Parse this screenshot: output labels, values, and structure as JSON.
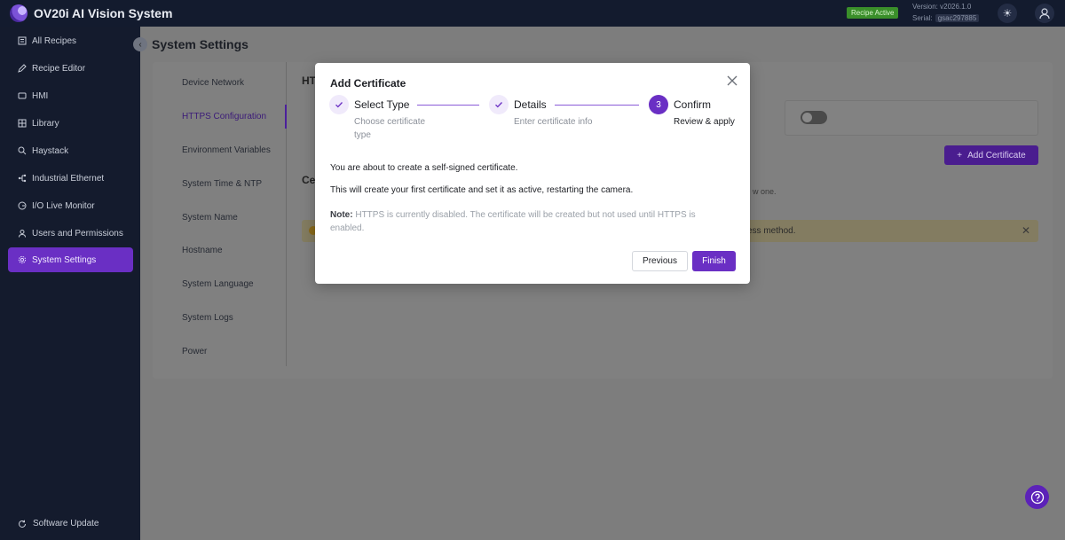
{
  "app": {
    "title": "OV20i AI Vision System",
    "recipe_status": "Recipe Active",
    "version": "Version: v2026.1.0",
    "serial_label": "Serial:",
    "serial_value": "gsac297885"
  },
  "sidebar": {
    "items": [
      {
        "label": "All Recipes",
        "icon": "list-icon"
      },
      {
        "label": "Recipe Editor",
        "icon": "edit-icon"
      },
      {
        "label": "HMI",
        "icon": "monitor-icon"
      },
      {
        "label": "Library",
        "icon": "grid-icon"
      },
      {
        "label": "Haystack",
        "icon": "search-icon"
      },
      {
        "label": "Industrial Ethernet",
        "icon": "network-icon"
      },
      {
        "label": "I/O Live Monitor",
        "icon": "io-icon"
      },
      {
        "label": "Users and Permissions",
        "icon": "user-icon"
      },
      {
        "label": "System Settings",
        "icon": "gear-icon",
        "active": true
      }
    ],
    "software_update": "Software Update"
  },
  "page": {
    "title": "System Settings",
    "settings_menu": [
      "Device Network",
      "HTTPS Configuration",
      "Environment Variables",
      "System Time & NTP",
      "System Name",
      "Hostname",
      "System Language",
      "System Logs",
      "Power"
    ],
    "active_settings_item": "HTTPS Configuration",
    "section_fragment_1": "HT",
    "section_fragment_2": "Ce",
    "add_certificate_label": "Add Certificate",
    "bg_text_fragment": "w one.",
    "alert_fragment": "ess method."
  },
  "modal": {
    "title": "Add Certificate",
    "steps": [
      {
        "title": "Select Type",
        "desc_line1": "Choose certificate",
        "desc_line2": "type",
        "status": "done"
      },
      {
        "title": "Details",
        "desc_line1": "Enter certificate info",
        "status": "done"
      },
      {
        "title": "Confirm",
        "number": "3",
        "desc_line1": "Review & apply",
        "status": "current"
      }
    ],
    "para1": "You are about to create a self-signed certificate.",
    "para2": "This will create your first certificate and set it as active, restarting the camera.",
    "note_label": "Note:",
    "note_text": " HTTPS is currently disabled. The certificate will be created but not used until HTTPS is enabled.",
    "previous_label": "Previous",
    "finish_label": "Finish"
  },
  "colors": {
    "accent": "#6a2fc4",
    "topbar": "#131b2e",
    "sidebar": "#141b2d",
    "recipe_badge": "#3a8f2a"
  }
}
